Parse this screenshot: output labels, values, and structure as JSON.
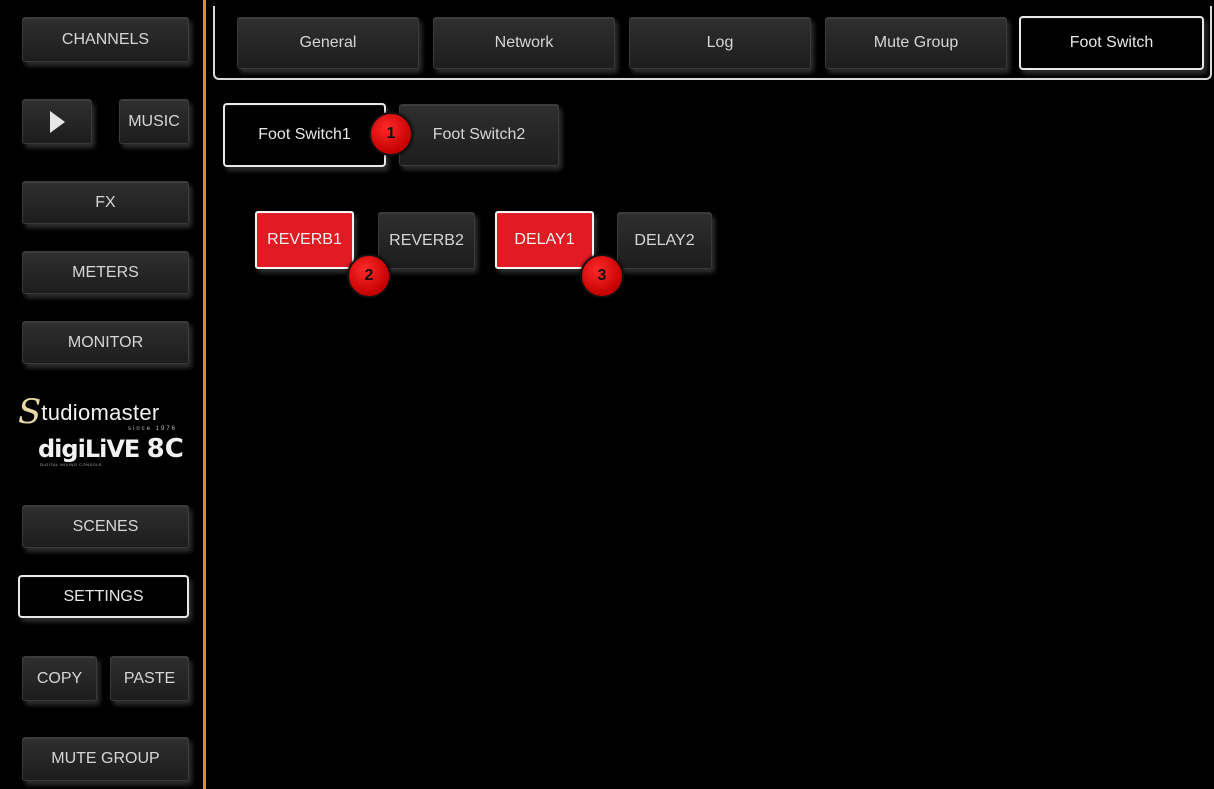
{
  "sidebar": {
    "channels_label": "CHANNELS",
    "play_icon": "play-icon",
    "music_label": "MUSIC",
    "fx_label": "FX",
    "meters_label": "METERS",
    "monitor_label": "MONITOR",
    "scenes_label": "SCENES",
    "settings_label": "SETTINGS",
    "copy_label": "COPY",
    "paste_label": "PASTE",
    "mute_group_label": "MUTE GROUP"
  },
  "logo": {
    "brand_initial": "S",
    "brand_rest": "tudiomaster",
    "since": "since 1976",
    "product": "digiLiVE",
    "model": "8C",
    "product_sub": "DIGITAL MIXING CONSOLE"
  },
  "tabs": [
    {
      "label": "General"
    },
    {
      "label": "Network"
    },
    {
      "label": "Log"
    },
    {
      "label": "Mute Group"
    },
    {
      "label": "Foot Switch",
      "selected": true
    }
  ],
  "footswitch": {
    "fs1_label": "Foot Switch1",
    "fs2_label": "Foot Switch2",
    "fx_buttons": [
      {
        "label": "REVERB1",
        "active": true
      },
      {
        "label": "REVERB2",
        "active": false
      },
      {
        "label": "DELAY1",
        "active": true
      },
      {
        "label": "DELAY2",
        "active": false
      }
    ]
  },
  "badges": [
    "1",
    "2",
    "3"
  ],
  "colors": {
    "accent_orange": "#e98a1c",
    "active_red": "#e21a24",
    "badge_red": "#d60000"
  }
}
